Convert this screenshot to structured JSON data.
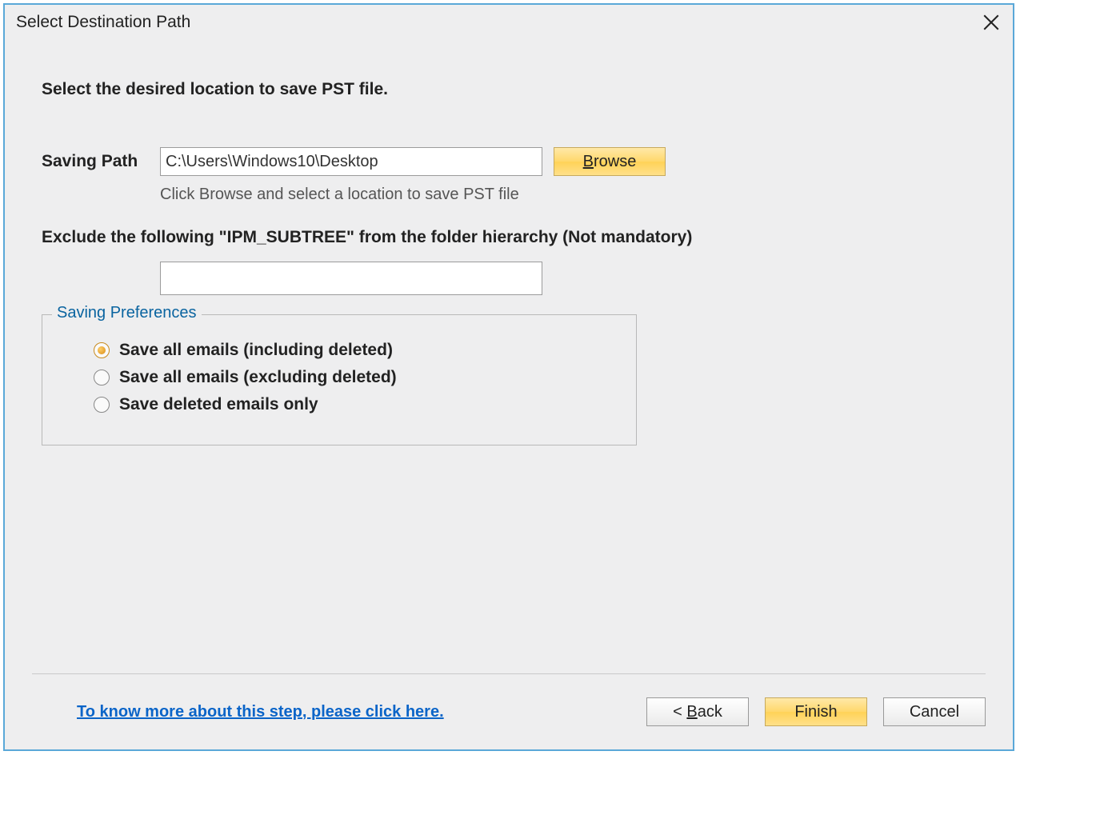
{
  "title": "Select Destination Path",
  "heading": "Select the desired location to save PST file.",
  "savingPath": {
    "label": "Saving Path",
    "value": "C:\\Users\\Windows10\\Desktop",
    "hint": "Click Browse and select a location to save PST file",
    "browse_prefix": "B",
    "browse_rest": "rowse"
  },
  "exclude": {
    "label": "Exclude the following \"IPM_SUBTREE\" from the folder hierarchy (Not mandatory)",
    "value": ""
  },
  "prefs": {
    "legend": "Saving Preferences",
    "options": [
      {
        "label": "Save all emails (including deleted)",
        "checked": true
      },
      {
        "label": "Save all emails (excluding deleted)",
        "checked": false
      },
      {
        "label": "Save deleted emails only",
        "checked": false
      }
    ]
  },
  "helpLink": "To know more about this step, please click here.",
  "buttons": {
    "back_prefix": "< ",
    "back_ul": "B",
    "back_rest": "ack",
    "finish": "Finish",
    "cancel": "Cancel"
  }
}
